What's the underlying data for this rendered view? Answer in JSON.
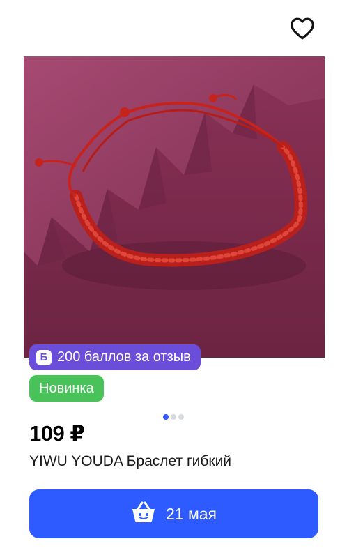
{
  "favorite": {
    "icon": "heart-outline-icon"
  },
  "product": {
    "image_alt": "red braided bracelet on purple fabric",
    "points_badge": {
      "icon": "bonus-b-icon",
      "icon_letter": "Б",
      "label": "200 баллов за отзыв"
    },
    "new_badge": "Новинка",
    "gallery": {
      "count": 3,
      "active": 0
    },
    "price": "109 ₽",
    "title": "YIWU YOUDA Браслет гибкий"
  },
  "cta": {
    "icon": "basket-icon",
    "label": "21 мая"
  },
  "colors": {
    "accent": "#2e5bff",
    "points_badge": "#6a4dd8",
    "new_badge": "#49c25a",
    "text": "#1a1a1a"
  }
}
